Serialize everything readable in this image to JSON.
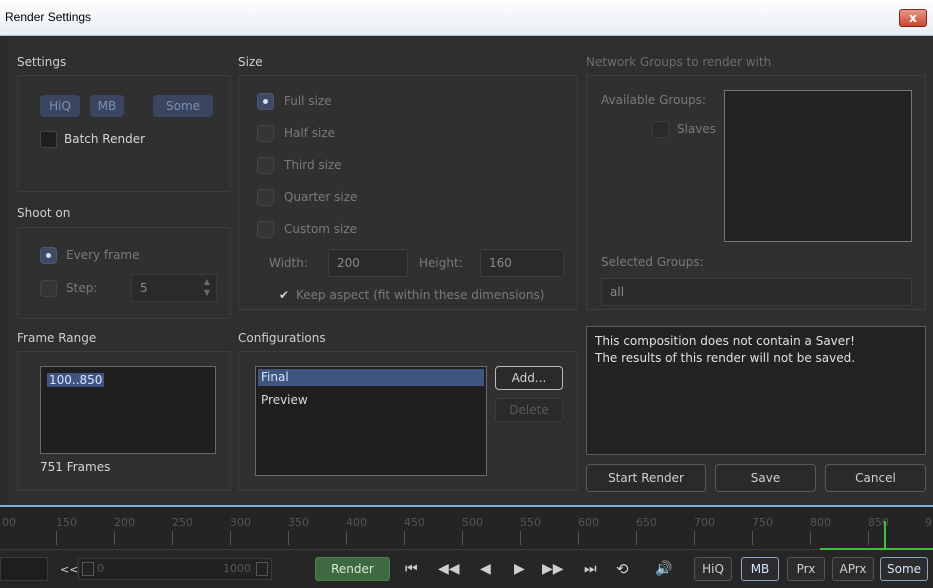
{
  "window": {
    "title": "Render Settings",
    "close_glyph": "x"
  },
  "settings": {
    "label": "Settings",
    "hiq": "HiQ",
    "mb": "MB",
    "some": "Some",
    "batch_render": "Batch Render"
  },
  "shoot_on": {
    "label": "Shoot on",
    "every_frame": "Every frame",
    "step": "Step:",
    "step_value": "5"
  },
  "size": {
    "label": "Size",
    "options": [
      "Full size",
      "Half size",
      "Third size",
      "Quarter size",
      "Custom size"
    ],
    "selected": "Full size",
    "width_label": "Width:",
    "width_value": "200",
    "height_label": "Height:",
    "height_value": "160",
    "keep_aspect": "Keep aspect (fit within these dimensions)"
  },
  "network": {
    "label": "Network Groups to render with",
    "available_label": "Available Groups:",
    "slaves": "Slaves",
    "selected_label": "Selected Groups:",
    "selected_value": "all"
  },
  "frame_range": {
    "label": "Frame Range",
    "value": "100..850",
    "frames": "751 Frames"
  },
  "configurations": {
    "label": "Configurations",
    "items": [
      "Final",
      "Preview"
    ],
    "selected": "Final",
    "add": "Add...",
    "delete": "Delete"
  },
  "message": {
    "line1": "This composition does not contain a Saver!",
    "line2": "The results of this render will not be saved."
  },
  "actions": {
    "start_render": "Start Render",
    "save": "Save",
    "cancel": "Cancel"
  },
  "timeline": {
    "ticks": [
      "00",
      "150",
      "200",
      "250",
      "300",
      "350",
      "400",
      "450",
      "500",
      "550",
      "600",
      "650",
      "700",
      "750",
      "800",
      "850",
      "9"
    ],
    "rewind": "<<",
    "start": "0",
    "end": "1000",
    "render": "Render",
    "hiq": "HiQ",
    "mb": "MB",
    "prx": "Prx",
    "aprx": "APrx",
    "some": "Some"
  },
  "colors": {
    "accent_blue": "#3f5580",
    "separator": "#7fb0d6",
    "render_green": "#3f6a3f"
  }
}
